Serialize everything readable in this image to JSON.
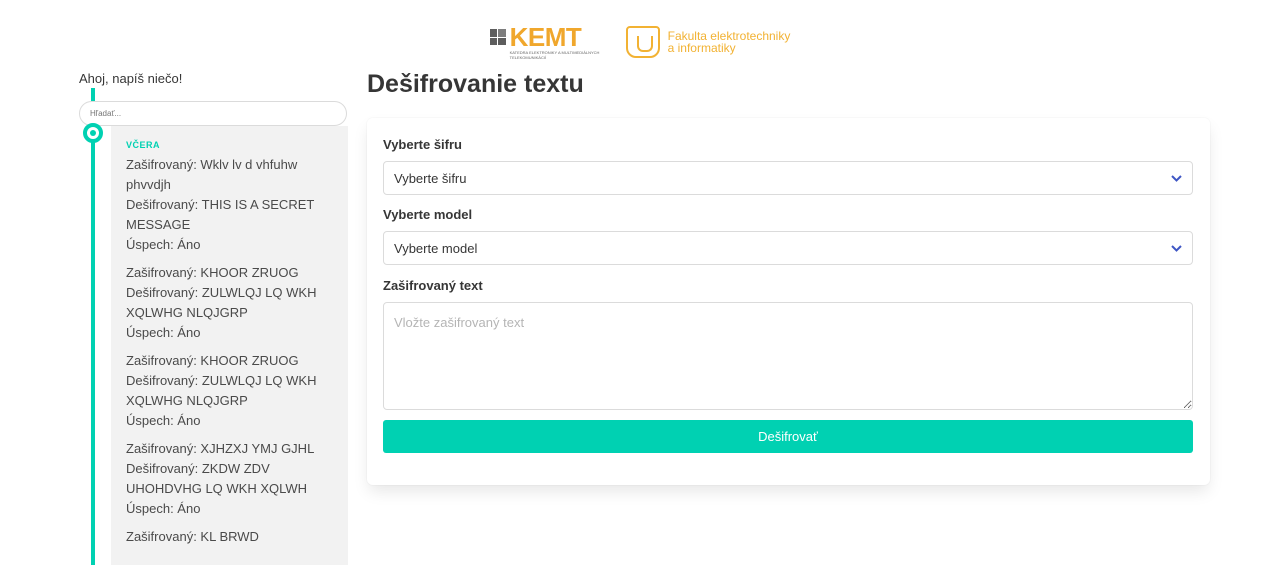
{
  "header": {
    "kemt_logo_text": "KEMT",
    "kemt_subtitle": "KATEDRA ELEKTRONIKY A MULTIMEDIÁLNYCH TELEKOMUNIKÁCIÍ",
    "fei_line1": "Fakulta elektrotechniky",
    "fei_line2": "a informatiky"
  },
  "sidebar": {
    "greeting": "Ahoj, napíš niečo!",
    "search_placeholder": "Hľadať...",
    "section_label": "VČERA",
    "entries": [
      {
        "encrypted": "Zašifrovaný: Wklv lv d vhfuhw phvvdjh",
        "decrypted": "Dešifrovaný: THIS IS A SECRET MESSAGE",
        "success": "Úspech: Áno"
      },
      {
        "encrypted": "Zašifrovaný: KHOOR ZRUOG",
        "decrypted": "Dešifrovaný: ZULWLQJ LQ WKH XQLWHG NLQJGRP",
        "success": "Úspech: Áno"
      },
      {
        "encrypted": "Zašifrovaný: KHOOR ZRUOG",
        "decrypted": "Dešifrovaný: ZULWLQJ LQ WKH XQLWHG NLQJGRP",
        "success": "Úspech: Áno"
      },
      {
        "encrypted": "Zašifrovaný: XJHZXJ YMJ GJHL",
        "decrypted": "Dešifrovaný: ZKDW ZDV UHOHDVHG LQ WKH XQLWH",
        "success": "Úspech: Áno"
      },
      {
        "encrypted": "Zašifrovaný: KL BRWD",
        "decrypted": "",
        "success": ""
      }
    ]
  },
  "main": {
    "title": "Dešifrovanie textu",
    "cipher_label": "Vyberte šifru",
    "cipher_value": "Vyberte šifru",
    "model_label": "Vyberte model",
    "model_value": "Vyberte model",
    "text_label": "Zašifrovaný text",
    "text_placeholder": "Vložte zašifrovaný text",
    "text_value": "",
    "submit_label": "Dešifrovať"
  },
  "colors": {
    "accent": "#00d1b2",
    "kemt_orange": "#f0a72c",
    "fei_yellow": "#f2b233",
    "chevron": "#3e56c4"
  }
}
